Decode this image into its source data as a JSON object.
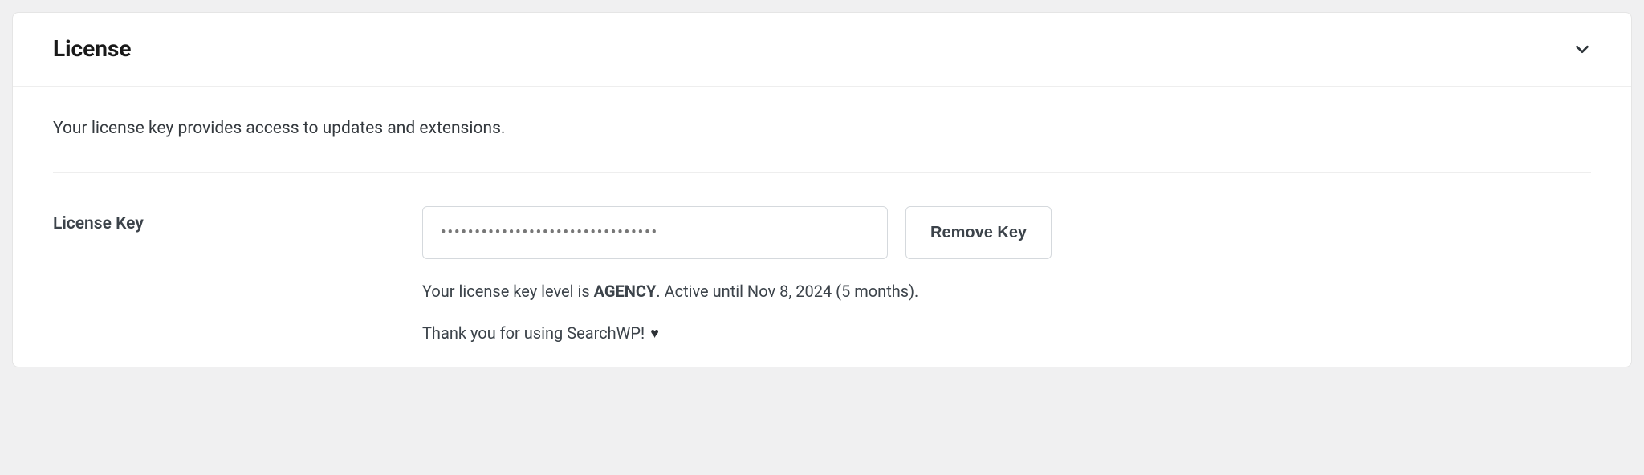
{
  "panel": {
    "title": "License",
    "description": "Your license key provides access to updates and extensions."
  },
  "form": {
    "label": "License Key",
    "masked_value": "••••••••••••••••••••••••••••••••",
    "remove_button": "Remove Key"
  },
  "status": {
    "prefix": "Your license key level is ",
    "level": "AGENCY",
    "suffix": ". Active until Nov 8, 2024 (5 months)."
  },
  "thanks": {
    "text": "Thank you for using SearchWP!"
  }
}
